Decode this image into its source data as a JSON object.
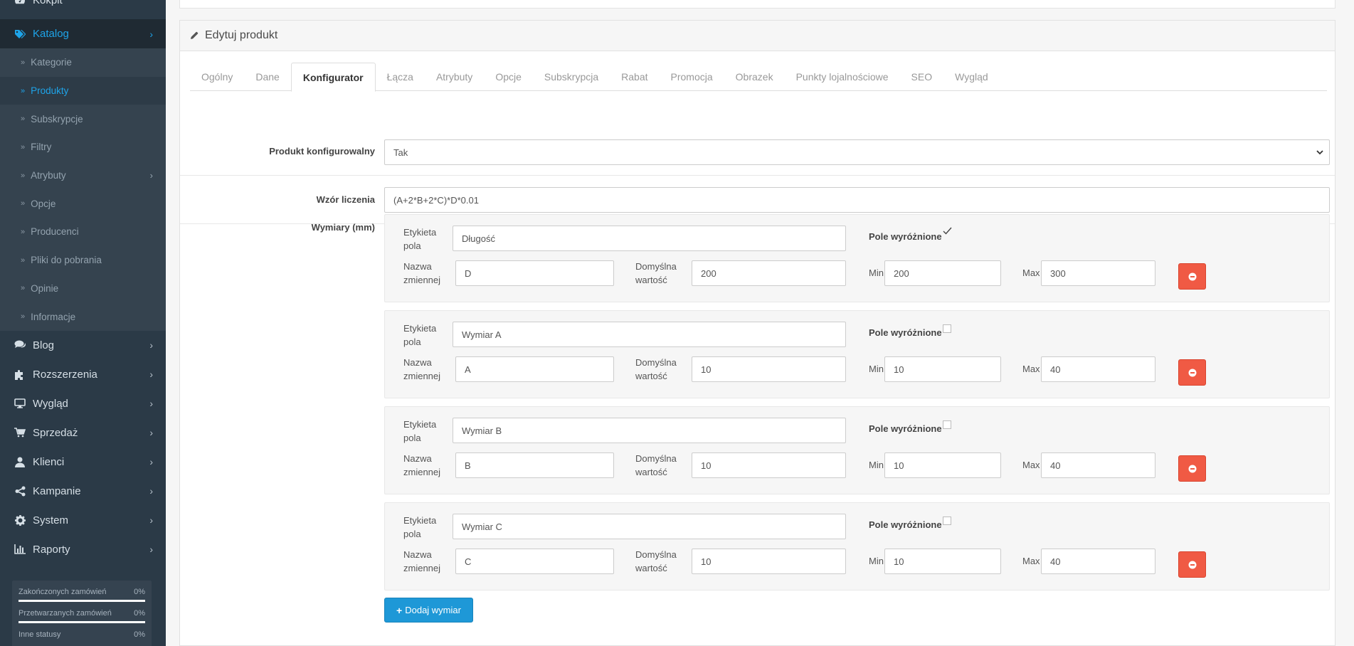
{
  "sidebar": {
    "kokpit": "Kokpit",
    "katalog": "Katalog",
    "catalog_items": [
      "Kategorie",
      "Produkty",
      "Subskrypcje",
      "Filtry",
      "Atrybuty",
      "Opcje",
      "Producenci",
      "Pliki do pobrania",
      "Opinie",
      "Informacje"
    ],
    "main_items": [
      "Blog",
      "Rozszerzenia",
      "Wygląd",
      "Sprzedaż",
      "Klienci",
      "Kampanie",
      "System",
      "Raporty"
    ],
    "stats": [
      {
        "label": "Zakończonych zamówień",
        "value": "0%"
      },
      {
        "label": "Przetwarzanych zamówień",
        "value": "0%"
      },
      {
        "label": "Inne statusy",
        "value": "0%"
      }
    ]
  },
  "panel": {
    "title": "Edytuj produkt"
  },
  "tabs": [
    "Ogólny",
    "Dane",
    "Konfigurator",
    "Łącza",
    "Atrybuty",
    "Opcje",
    "Subskrypcja",
    "Rabat",
    "Promocja",
    "Obrazek",
    "Punkty lojalnościowe",
    "SEO",
    "Wygląd"
  ],
  "active_tab": "Konfigurator",
  "form": {
    "configurable_label": "Produkt konfigurowalny",
    "configurable_value": "Tak",
    "formula_label": "Wzór liczenia",
    "formula_value": "(A+2*B+2*C)*D*0.01",
    "dimensions_label": "Wymiary (mm)"
  },
  "dimension_labels": {
    "label_l1": "Etykieta",
    "label_l2": "pola",
    "var_l1": "Nazwa",
    "var_l2": "zmiennej",
    "default_l1": "Domyślna",
    "default_l2": "wartość",
    "min": "Min",
    "max": "Max",
    "featured": "Pole wyróżnione"
  },
  "dimensions": [
    {
      "label": "Długość",
      "var": "D",
      "default": "200",
      "min": "200",
      "max": "300",
      "featured": true
    },
    {
      "label": "Wymiar A",
      "var": "A",
      "default": "10",
      "min": "10",
      "max": "40",
      "featured": false
    },
    {
      "label": "Wymiar B",
      "var": "B",
      "default": "10",
      "min": "10",
      "max": "40",
      "featured": false
    },
    {
      "label": "Wymiar C",
      "var": "C",
      "default": "10",
      "min": "10",
      "max": "40",
      "featured": false
    }
  ],
  "add_button": "Dodaj wymiar",
  "colors": {
    "accent": "#1ea4e9",
    "danger": "#f05a44",
    "sidebar": "#2b3a47"
  }
}
